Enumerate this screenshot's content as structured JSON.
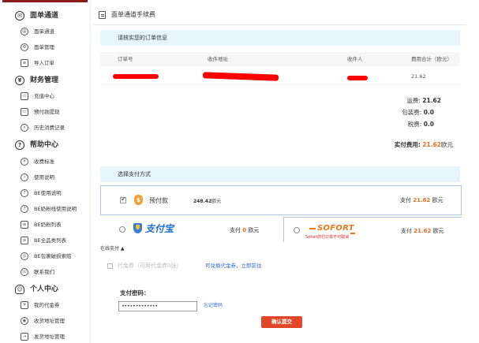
{
  "sidebar": {
    "sections": [
      {
        "title": "面单通道",
        "icon": "mail-icon",
        "items": [
          {
            "label": "面单通道",
            "icon": "at-icon"
          },
          {
            "label": "面单管理",
            "icon": "gear-icon"
          },
          {
            "label": "导入订单",
            "icon": "import-icon"
          }
        ]
      },
      {
        "title": "财务管理",
        "icon": "yen-icon",
        "items": [
          {
            "label": "充值中心",
            "icon": "recharge-icon"
          },
          {
            "label": "预付款提现",
            "icon": "withdraw-icon"
          },
          {
            "label": "历史消费记录",
            "icon": "history-search-icon"
          }
        ]
      },
      {
        "title": "帮助中心",
        "icon": "question-icon",
        "items": [
          {
            "label": "收费标准",
            "icon": "yen-small-icon"
          },
          {
            "label": "使用说明",
            "icon": "info-icon"
          },
          {
            "label": "BE使用说明",
            "icon": "question-small-icon"
          },
          {
            "label": "BE奶粉线使用说明",
            "icon": "question-small-icon"
          },
          {
            "label": "BE奶粉列表",
            "icon": "document-icon"
          },
          {
            "label": "BE全品类列表",
            "icon": "document-icon"
          },
          {
            "label": "BE包裹破损索赔",
            "icon": "claim-icon"
          },
          {
            "label": "联系我们",
            "icon": "phone-icon"
          }
        ]
      },
      {
        "title": "个人中心",
        "icon": "person-icon",
        "items": [
          {
            "label": "我的代金券",
            "icon": "voucher-icon"
          },
          {
            "label": "收货地址管理",
            "icon": "location-icon"
          },
          {
            "label": "发货地址管理",
            "icon": "send-icon"
          }
        ]
      }
    ]
  },
  "header": {
    "title": "面单通道手续费"
  },
  "order_section": {
    "title": "请核实您的订单信息",
    "columns": [
      "订单号",
      "收件地址",
      "收件人",
      "费用合计（欧元）"
    ],
    "row": {
      "amount": "21.62"
    }
  },
  "fees": {
    "shipping_label": "运费:",
    "shipping_value": "21.62",
    "packaging_label": "包装费:",
    "packaging_value": "0.0",
    "tax_label": "税费:",
    "tax_value": "0.0",
    "total_label": "实付费用:",
    "total_value": "21.62",
    "total_unit": "欧元"
  },
  "payment": {
    "title": "选择支付方式",
    "prepaid": {
      "label": "预付款",
      "balance": "248.42",
      "balance_unit": "欧元",
      "pay_prefix": "支付",
      "pay_amount": "21.62",
      "pay_unit": "欧元"
    },
    "alipay": {
      "label": "支付宝",
      "pay_prefix": "支付",
      "pay_amount": "0",
      "pay_unit": "欧元"
    },
    "sofort": {
      "label": "SOFORT",
      "note": "Sofort的付订单不可取消",
      "pay_prefix": "支付",
      "pay_amount": "21.62",
      "pay_unit": "欧元"
    },
    "more_label": "在线支付 ▲"
  },
  "voucher": {
    "label": "代金券（可用代金券0张）",
    "link": "可兑换代金券，立即前往"
  },
  "password": {
    "label": "支付密码：",
    "value": "•••••••••••••",
    "forgot": "忘记密码"
  },
  "submit_label": "确认提交",
  "colors": {
    "brand": "#8b1a1a",
    "accent": "#e4701e",
    "info_bg": "#e6f4fc",
    "submit": "#e2472a",
    "link": "#2a6ad6"
  }
}
